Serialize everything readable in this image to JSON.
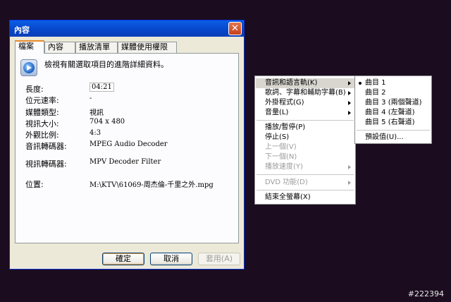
{
  "dialog": {
    "title": "內容",
    "close_glyph": "✕",
    "tabs": [
      "檔案",
      "內容",
      "播放清單",
      "媒體使用權限"
    ],
    "description": "檢視有關選取項目的進階詳細資料。",
    "properties": [
      {
        "label": "長度:",
        "value": "04:21"
      },
      {
        "label": "位元速率:",
        "value": "-"
      },
      {
        "label": "媒體類型:",
        "value": "視訊"
      },
      {
        "label": "視訊大小:",
        "value": "704 x 480"
      },
      {
        "label": "外觀比例:",
        "value": "4:3"
      },
      {
        "label": "音訊轉碼器:",
        "value": "MPEG Audio Decoder"
      },
      {
        "label": "視訊轉碼器:",
        "value": "MPV Decoder Filter"
      },
      {
        "label": "位置:",
        "value": "M:\\KTV\\61069-周杰倫-千里之外.mpg"
      }
    ],
    "buttons": {
      "ok": "確定",
      "cancel": "取消",
      "apply": "套用(A)"
    }
  },
  "context_menu": {
    "items": [
      {
        "label": "音訊和語言軌(K)",
        "submenu": true,
        "highlighted": true
      },
      {
        "label": "歌詞、字幕和輔助字幕(B)",
        "submenu": true
      },
      {
        "label": "外掛程式(G)",
        "submenu": true
      },
      {
        "label": "音量(L)",
        "submenu": true
      },
      {
        "label": "播放/暫停(P)"
      },
      {
        "label": "停止(S)"
      },
      {
        "label": "上一個(V)",
        "disabled": true
      },
      {
        "label": "下一個(N)",
        "disabled": true
      },
      {
        "label": "播放速度(Y)",
        "submenu": true,
        "disabled": true
      },
      {
        "label": "DVD 功能(D)",
        "submenu": true,
        "disabled": true
      },
      {
        "label": "結束全螢幕(X)"
      }
    ]
  },
  "submenu": {
    "items": [
      {
        "label": "曲目 1",
        "checked": true
      },
      {
        "label": "曲目 2"
      },
      {
        "label": "曲目 3 (兩個聲道)"
      },
      {
        "label": "曲目 4 (左聲道)"
      },
      {
        "label": "曲目 5 (右聲道)"
      },
      {
        "label": "預設值(U)..."
      }
    ]
  },
  "watermark": "#222394",
  "colors": {
    "titlebar": "#0a5fe6",
    "desktop": "#1b0c1f",
    "dialog_face": "#ece9d8",
    "tab_accent": "#e68b2c"
  }
}
